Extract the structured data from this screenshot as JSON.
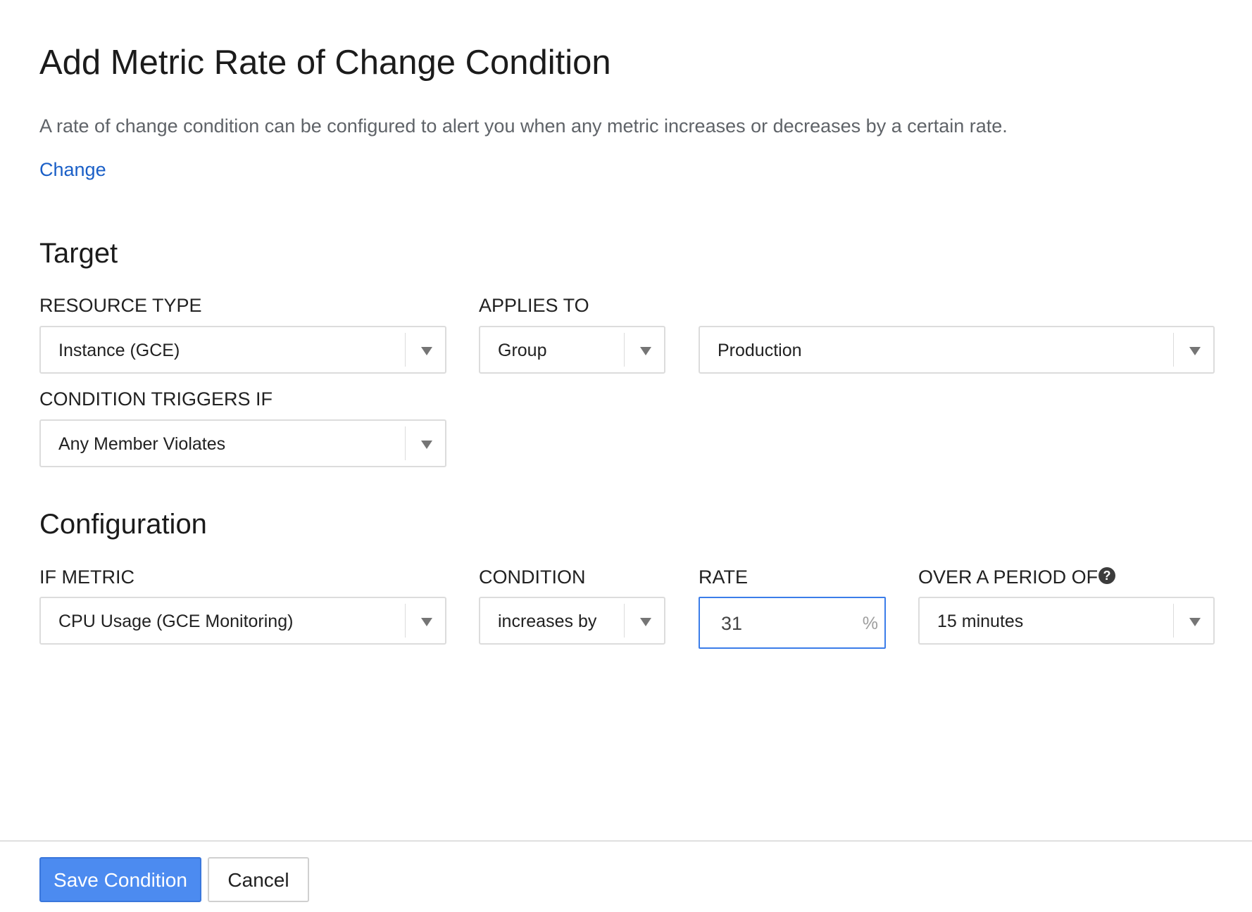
{
  "dialog": {
    "title": "Add Metric Rate of Change Condition",
    "description": "A rate of change condition can be configured to alert you when any metric increases or decreases by a certain rate.",
    "change_link": "Change"
  },
  "target": {
    "section_title": "Target",
    "resource_type": {
      "label": "RESOURCE TYPE",
      "value": "Instance (GCE)"
    },
    "applies_to": {
      "label": "APPLIES TO",
      "value": "Group"
    },
    "group": {
      "value": "Production"
    },
    "condition_triggers": {
      "label": "CONDITION TRIGGERS IF",
      "value": "Any Member Violates"
    }
  },
  "configuration": {
    "section_title": "Configuration",
    "if_metric": {
      "label": "IF METRIC",
      "value": "CPU Usage (GCE Monitoring)"
    },
    "condition": {
      "label": "CONDITION",
      "value": "increases by"
    },
    "rate": {
      "label": "RATE",
      "value": "31",
      "unit": "%"
    },
    "period": {
      "label": "OVER A PERIOD OF",
      "value": "15 minutes",
      "help_icon": "question-circle-icon"
    }
  },
  "footer": {
    "save_label": "Save Condition",
    "cancel_label": "Cancel"
  },
  "colors": {
    "link": "#1a5fc7",
    "primary_button": "#4c8bf0",
    "focus_border": "#3b7de9"
  }
}
